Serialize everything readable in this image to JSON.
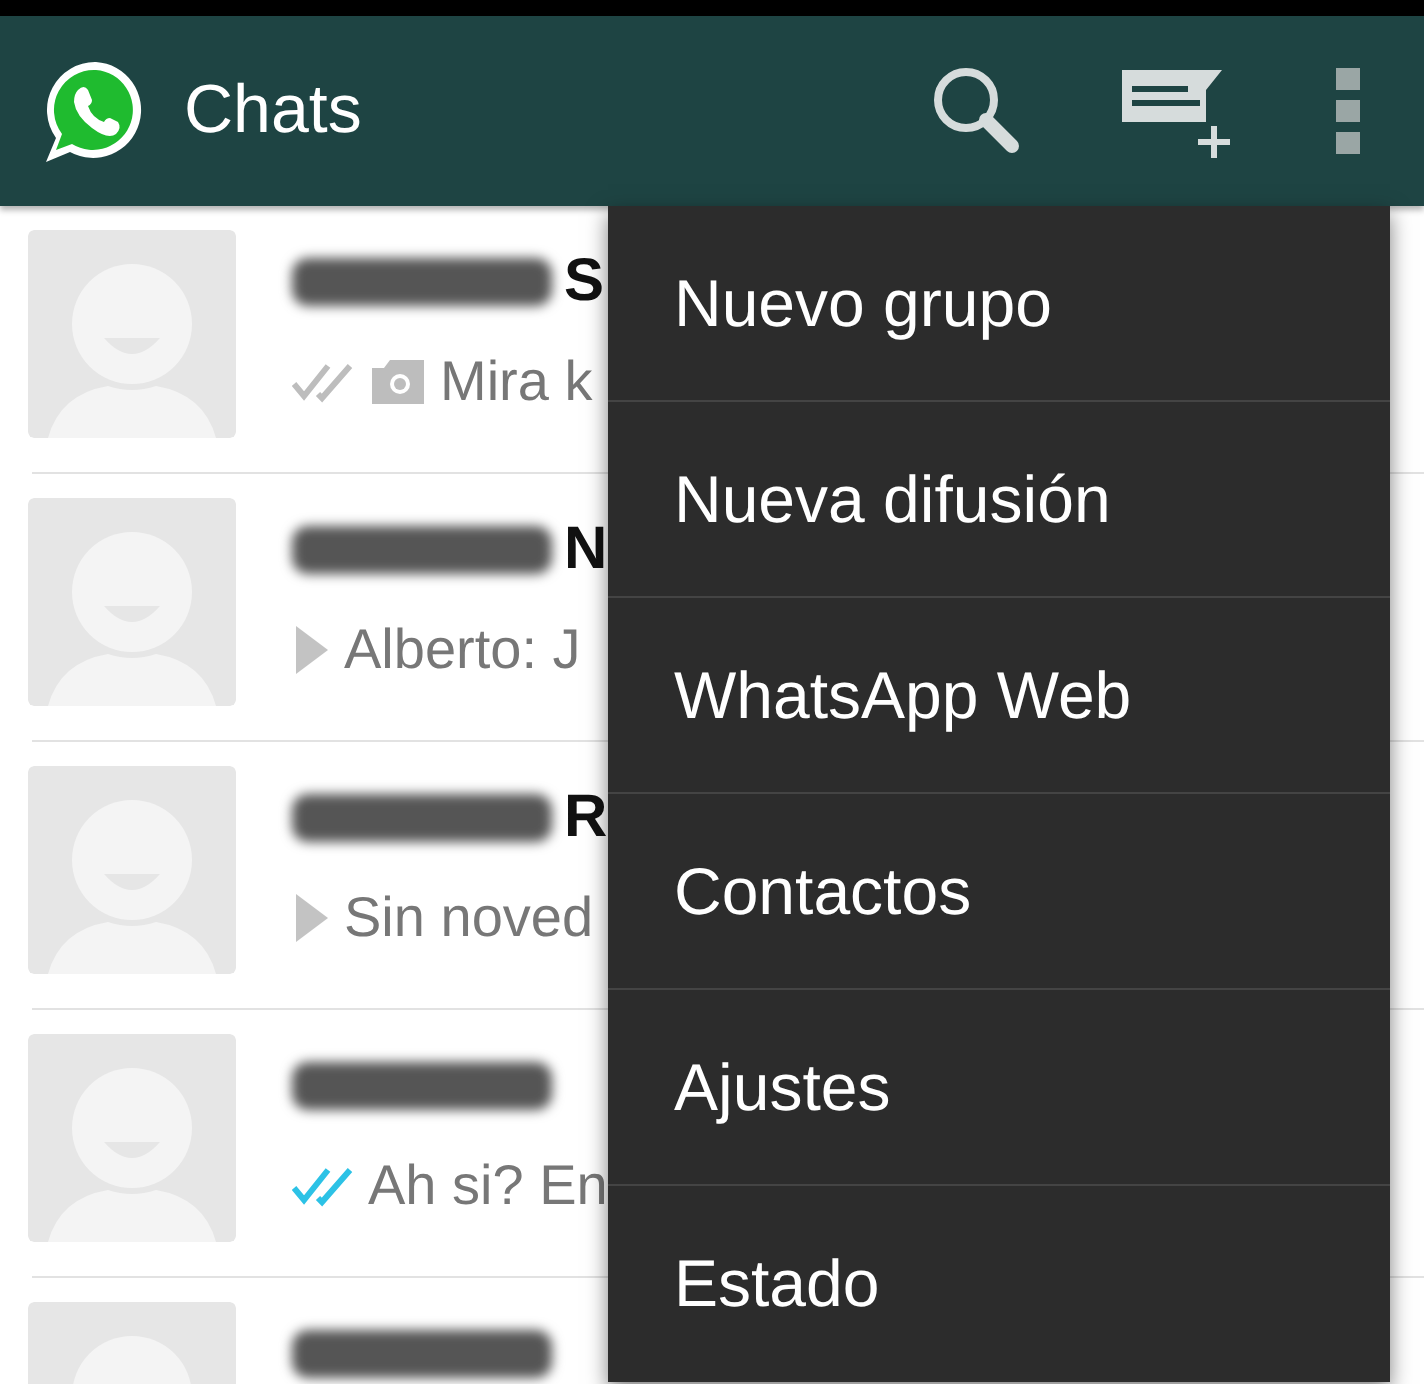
{
  "toolbar": {
    "title": "Chats"
  },
  "chats": [
    {
      "name_blurred": true,
      "name_visible": "S",
      "icons": [
        {
          "kind": "ticks",
          "read": false
        },
        {
          "kind": "camera"
        }
      ],
      "preview": "Mira k"
    },
    {
      "name_blurred": true,
      "name_visible": "N",
      "icons": [
        {
          "kind": "arrow"
        }
      ],
      "preview": "Alberto: J"
    },
    {
      "name_blurred": true,
      "name_visible": "R",
      "icons": [
        {
          "kind": "arrow"
        }
      ],
      "preview": "Sin noved"
    },
    {
      "name_blurred": true,
      "icons": [
        {
          "kind": "ticks",
          "read": true
        }
      ],
      "preview": "Ah si? En"
    },
    {
      "name_blurred": true
    }
  ],
  "menu": {
    "items": [
      "Nuevo grupo",
      "Nueva difusión",
      "WhatsApp Web",
      "Contactos",
      "Ajustes",
      "Estado"
    ]
  }
}
